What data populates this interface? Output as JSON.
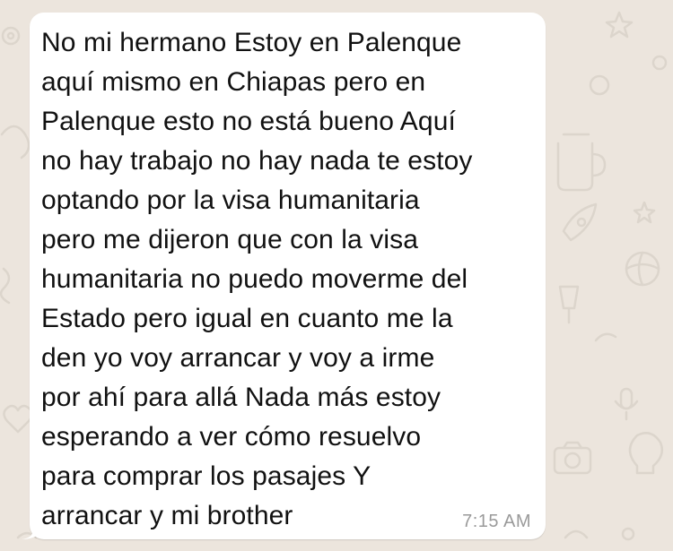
{
  "colors": {
    "background": "#ece5dd",
    "bubble": "#ffffff",
    "text": "#111111",
    "timestamp": "#9a9a9a",
    "doodle": "#dcd5cc"
  },
  "message": {
    "lines": [
      "No mi hermano Estoy en Palenque",
      "aquí mismo en Chiapas pero en",
      "Palenque esto no está bueno Aquí",
      "no hay trabajo no hay nada te estoy",
      "optando por la visa humanitaria",
      "pero me dijeron que con la visa",
      "humanitaria no puedo moverme del",
      "Estado pero igual en cuanto me la",
      "den yo voy arrancar y voy a irme",
      "por ahí para allá Nada más estoy",
      "esperando a ver cómo resuelvo",
      "para comprar los pasajes Y",
      "arrancar y mi brother"
    ],
    "time": "7:15 AM"
  },
  "wallpaper": {
    "icons": [
      "gear-doodle",
      "cup-doodle",
      "star-doodle",
      "ball-doodle",
      "mic-doodle",
      "camera-doodle",
      "heart-doodle",
      "swirl-doodle"
    ]
  }
}
